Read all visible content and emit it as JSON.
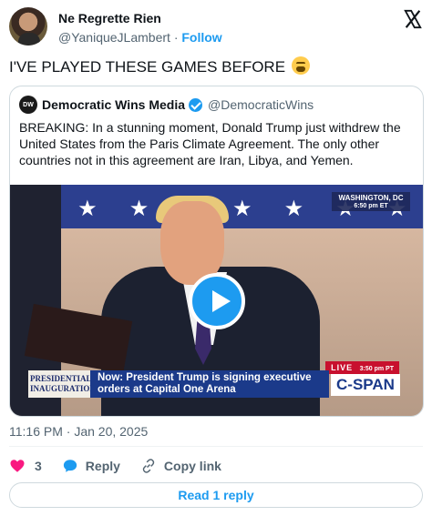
{
  "author": {
    "display_name": "Ne Regrette Rien",
    "handle": "@YaniqueJLambert",
    "separator": "·",
    "follow_label": "Follow"
  },
  "tweet": {
    "text": "I'VE PLAYED THESE GAMES BEFORE",
    "emoji_icon": "weary-face-icon",
    "timestamp": "11:16 PM · Jan 20, 2025"
  },
  "quoted_tweet": {
    "logo_text": "DW",
    "name": "Democratic Wins Media",
    "handle": "@DemocraticWins",
    "text": "BREAKING:  In a stunning moment, Donald Trump just withdrew the United States from the Paris Climate Agreement.  The only other countries not in this agreement are Iran, Libya, and Yemen."
  },
  "video": {
    "location": "WASHINGTON, DC",
    "location_time": "6:50 pm ET",
    "live_label": "LIVE",
    "live_time": "3:50 pm PT",
    "program_label_1": "PRESIDENTIAL",
    "program_label_2": "INAUGURATION",
    "headline": "Now: President Trump is signing executive orders at Capital One Arena",
    "network": "C-SPAN"
  },
  "actions": {
    "like_count": "3",
    "reply_label": "Reply",
    "copy_link_label": "Copy link"
  },
  "read_replies_label": "Read 1 reply",
  "colors": {
    "accent": "#1d9bf0",
    "like": "#f91880",
    "muted": "#536471"
  }
}
